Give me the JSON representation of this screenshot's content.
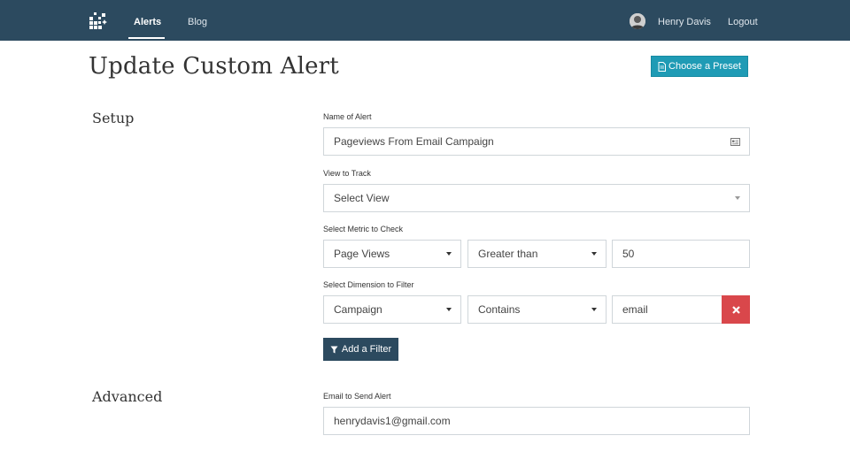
{
  "nav": {
    "alerts": "Alerts",
    "blog": "Blog",
    "user": "Henry Davis",
    "logout": "Logout"
  },
  "page": {
    "title": "Update Custom Alert",
    "preset_button": "Choose a Preset"
  },
  "setup": {
    "title": "Setup",
    "name_label": "Name of Alert",
    "name_value": "Pageviews From Email Campaign",
    "view_label": "View to Track",
    "view_value": "Select View",
    "metric_label": "Select Metric to Check",
    "metric_value": "Page Views",
    "metric_operator": "Greater than",
    "metric_threshold": "50",
    "dimension_label": "Select Dimension to Filter",
    "dimension_value": "Campaign",
    "dimension_operator": "Contains",
    "dimension_match": "email",
    "add_filter_button": "Add a Filter"
  },
  "advanced": {
    "title": "Advanced",
    "email_label": "Email to Send Alert",
    "email_value": "henrydavis1@gmail.com"
  },
  "colors": {
    "navbar": "#2c4a5f",
    "preset_button": "#1f9bb5",
    "remove_button": "#d9474b"
  }
}
